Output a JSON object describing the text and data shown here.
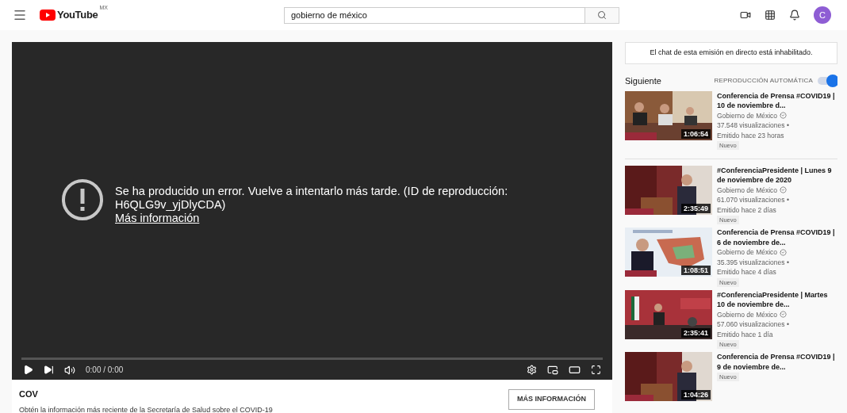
{
  "header": {
    "logo_text": "YouTube",
    "region": "MX",
    "search": {
      "value": "gobierno de méxico"
    },
    "avatar_letter": "C"
  },
  "player": {
    "error": {
      "message": "Se ha producido un error. Vuelve a intentarlo más tarde. (ID de reproducción: H6QLG9v_yjDlyCDA)",
      "link": "Más información"
    },
    "time": "0:00 / 0:00"
  },
  "info_panel": {
    "heading": "COV",
    "text": "Obtén la información más reciente de la Secretaría de Salud sobre el COVID-19",
    "button": "MÁS INFORMACIÓN"
  },
  "sidebar": {
    "chat_notice": "El chat de esta emisión en directo está inhabilitado.",
    "up_next": "Siguiente",
    "autoplay": {
      "label": "REPRODUCCIÓN AUTOMÁTICA",
      "on": true
    },
    "videos": [
      {
        "title": "Conferencia de Prensa #COVID19 | 10 de noviembre d...",
        "channel": "Gobierno de México",
        "views": "37.548 visualizaciones •",
        "age": "Emitido hace 23 horas",
        "badge": "Nuevo",
        "duration": "1:06:54"
      },
      {
        "title": "#ConferenciaPresidente | Lunes 9 de noviembre de 2020",
        "channel": "Gobierno de México",
        "views": "61.070 visualizaciones •",
        "age": "Emitido hace 2 días",
        "badge": "Nuevo",
        "duration": "2:35:49"
      },
      {
        "title": "Conferencia de Prensa #COVID19 | 6 de noviembre de...",
        "channel": "Gobierno de México",
        "views": "35.395 visualizaciones •",
        "age": "Emitido hace 4 días",
        "badge": "Nuevo",
        "duration": "1:08:51"
      },
      {
        "title": "#ConferenciaPresidente | Martes 10 de noviembre de...",
        "channel": "Gobierno de México",
        "views": "57.060 visualizaciones •",
        "age": "Emitido hace 1 día",
        "badge": "Nuevo",
        "duration": "2:35:41"
      },
      {
        "title": "Conferencia de Prensa #COVID19 | 9 de noviembre de...",
        "badge": "Nuevo",
        "duration": "1:04:26"
      }
    ]
  }
}
